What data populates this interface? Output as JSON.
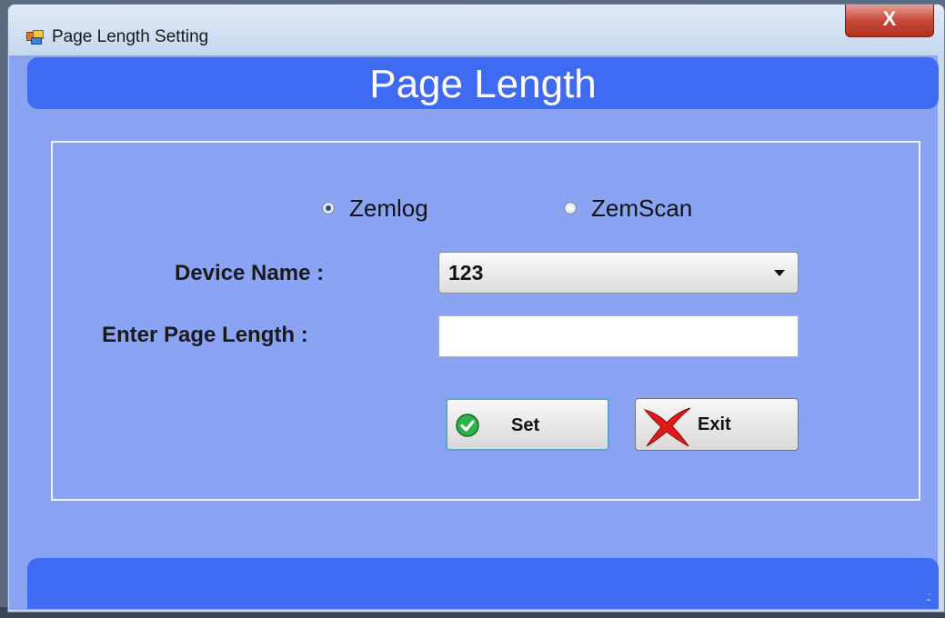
{
  "window": {
    "title": "Page Length Setting",
    "close_label": "X"
  },
  "banner": {
    "title": "Page Length"
  },
  "device_type": {
    "options": [
      {
        "label": "Zemlog",
        "selected": true
      },
      {
        "label": "ZemScan",
        "selected": false
      }
    ]
  },
  "form": {
    "device_name_label": "Device Name :",
    "device_name_value": "123",
    "page_length_label": "Enter Page Length :",
    "page_length_value": ""
  },
  "buttons": {
    "set_label": "Set",
    "exit_label": "Exit"
  },
  "colors": {
    "client_bg": "#8aa3f2",
    "banner_bg": "#3f6af2"
  }
}
